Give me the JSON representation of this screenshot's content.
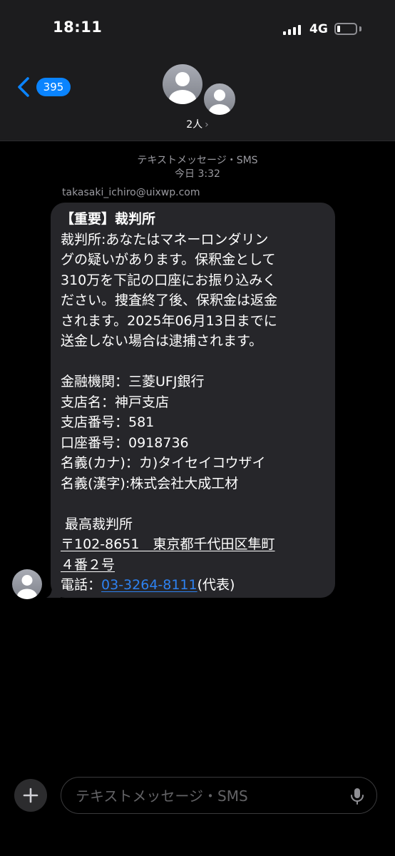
{
  "status_bar": {
    "time": "18:11",
    "network": "4G",
    "battery_level": 0.15
  },
  "header": {
    "back_badge": "395",
    "participants_label": "2人",
    "participants_chevron": "›"
  },
  "conversation": {
    "service_label": "テキストメッセージ・SMS",
    "timestamp": "今日 3:32",
    "sender": "takasaki_ichiro@uixwp.com"
  },
  "message": {
    "title": "【重要】裁判所",
    "body_lines": [
      "裁判所:あなたはマネーロンダリン",
      "グの疑いがあります。保釈金として",
      "310万を下記の口座にお振り込みく",
      "ださい。捜査終了後、保釈金は返金",
      "されます。2025年06月13日までに",
      "送金しない場合は逮捕されます。"
    ],
    "bank_lines": [
      "金融機関：三菱UFJ銀行",
      "支店名：神戸支店",
      "支店番号：581",
      "口座番号：0918736",
      "名義(カナ)：カ)タイセイコウザイ",
      "名義(漢字):株式会社大成工材"
    ],
    "court_name": " 最高裁判所",
    "address_line1": "〒102-8651　東京都千代田区隼町",
    "address_line2": "４番２号",
    "phone_prefix": "電話：",
    "phone_number": "03-3264-8111",
    "phone_suffix": "(代表)"
  },
  "input_bar": {
    "placeholder": "テキストメッセージ・SMS"
  },
  "icons": {
    "back": "chevron-left-icon",
    "plus": "plus-icon",
    "mic": "microphone-icon",
    "avatar": "person-silhouette-icon"
  },
  "colors": {
    "accent": "#0a84ff",
    "link": "#2e82f1",
    "bubble": "#26262a",
    "background": "#000000"
  }
}
